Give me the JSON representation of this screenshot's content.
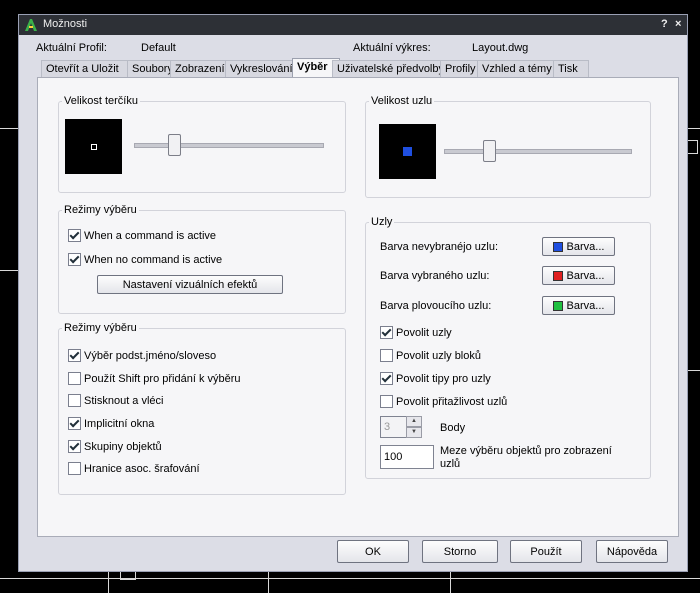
{
  "window": {
    "title": "Možnosti",
    "help_label": "?",
    "close_label": "×"
  },
  "profile": {
    "current_profile_label": "Aktuální Profil:",
    "current_profile_value": "Default",
    "current_drawing_label": "Aktuální výkres:",
    "current_drawing_value": "Layout.dwg"
  },
  "tabs": [
    {
      "label": "Otevřít a Uložit"
    },
    {
      "label": "Soubory"
    },
    {
      "label": "Zobrazení"
    },
    {
      "label": "Vykreslování"
    },
    {
      "label": "Výběr"
    },
    {
      "label": "Uživatelské předvolby"
    },
    {
      "label": "Profily"
    },
    {
      "label": "Vzhled a témy"
    },
    {
      "label": "Tisk"
    }
  ],
  "active_tab": "Výběr",
  "pickbox": {
    "title": "Velikost terčíku",
    "slider_level": 0.19
  },
  "grip_size": {
    "title": "Velikost uzlu",
    "slider_level": 0.22
  },
  "selection_modes_1": {
    "title": "Režimy výběru",
    "when_command_active": {
      "label": "When a command is active",
      "checked": true
    },
    "when_no_command": {
      "label": "When no command is active",
      "checked": true
    },
    "visual_effects_button": "Nastavení vizuálních efektů"
  },
  "selection_modes_2": {
    "title": "Režimy výběru",
    "items": [
      {
        "label": "Výběr podst.jméno/sloveso",
        "checked": true
      },
      {
        "label": "Použít Shift pro přidání k výběru",
        "checked": false
      },
      {
        "label": "Stisknout a vléci",
        "checked": false
      },
      {
        "label": "Implicitní okna",
        "checked": true
      },
      {
        "label": "Skupiny objektů",
        "checked": true
      },
      {
        "label": "Hranice asoc. šrafování",
        "checked": false
      }
    ]
  },
  "grips": {
    "title": "Uzly",
    "unselected_label": "Barva nevybranéjo uzlu:",
    "selected_label": "Barva vybraného uzlu:",
    "hover_label": "Barva plovoucího uzlu:",
    "color_button_label": "Barva...",
    "unselected_color": "#1f4fe0",
    "selected_color": "#e02020",
    "hover_color": "#20c040",
    "checks": [
      {
        "label": "Povolit uzly",
        "checked": true
      },
      {
        "label": "Povolit uzly bloků",
        "checked": false
      },
      {
        "label": "Povolit tipy pro uzly",
        "checked": true
      },
      {
        "label": "Povolit přitažlivost uzlů",
        "checked": false
      }
    ],
    "body_value": "3",
    "body_label": "Body",
    "limit_value": "100",
    "limit_label": "Meze výběru objektů pro zobrazení uzlů"
  },
  "buttons": {
    "ok": "OK",
    "cancel": "Storno",
    "apply": "Použít",
    "help": "Nápověda"
  }
}
